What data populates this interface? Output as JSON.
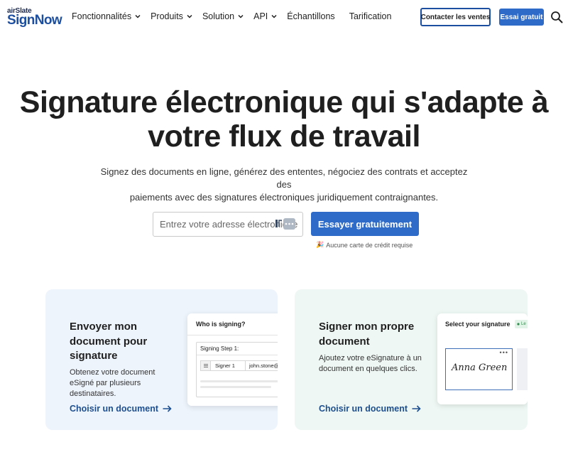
{
  "brand": {
    "small": "airSlate",
    "name": "SignNow",
    "colors": {
      "primary": "#2e6bc9",
      "dark_blue": "#1d4fa0",
      "card_blue_bg": "#eef4fc",
      "card_green_bg": "#eef7f3"
    }
  },
  "nav": {
    "items": [
      {
        "label": "Fonctionnalités",
        "dropdown": true
      },
      {
        "label": "Produits",
        "dropdown": true
      },
      {
        "label": "Solution",
        "dropdown": true
      },
      {
        "label": "API",
        "dropdown": true
      },
      {
        "label": "Échantillons",
        "dropdown": false
      },
      {
        "label": "Tarification",
        "dropdown": false
      }
    ],
    "contact_label": "Contacter les ventes",
    "trial_label": "Essai gratuit",
    "search_icon": "search-icon"
  },
  "hero": {
    "title_line1": "Signature électronique qui s'adapte à",
    "title_line2": "votre flux de travail",
    "subtitle_line1": "Signez des documents en ligne, générez des ententes, négociez des contrats et acceptez des",
    "subtitle_line2": "paiements avec des signatures électroniques juridiquement contraignantes.",
    "email_placeholder": "Entrez votre adresse électronique",
    "cta_label": "Essayer gratuitement",
    "no_card_emoji": "🎉",
    "no_card_note": "Aucune carte de crédit requise"
  },
  "cards": [
    {
      "title": "Envoyer mon document pour signature",
      "text": "Obtenez votre document eSigné par plusieurs destinataires.",
      "link": "Choisir un document",
      "mock": {
        "heading": "Who is signing?",
        "step_label": "Signing Step 1:",
        "signer_role": "Signer 1",
        "signer_email": "john.stone@"
      }
    },
    {
      "title": "Signer mon propre document",
      "text": "Ajoutez votre eSignature à un document en quelques clics.",
      "link": "Choisir un document",
      "mock": {
        "heading": "Select your signature",
        "tag": "Le",
        "signature_text": "Anna Green",
        "more_dots": "•••"
      }
    }
  ]
}
